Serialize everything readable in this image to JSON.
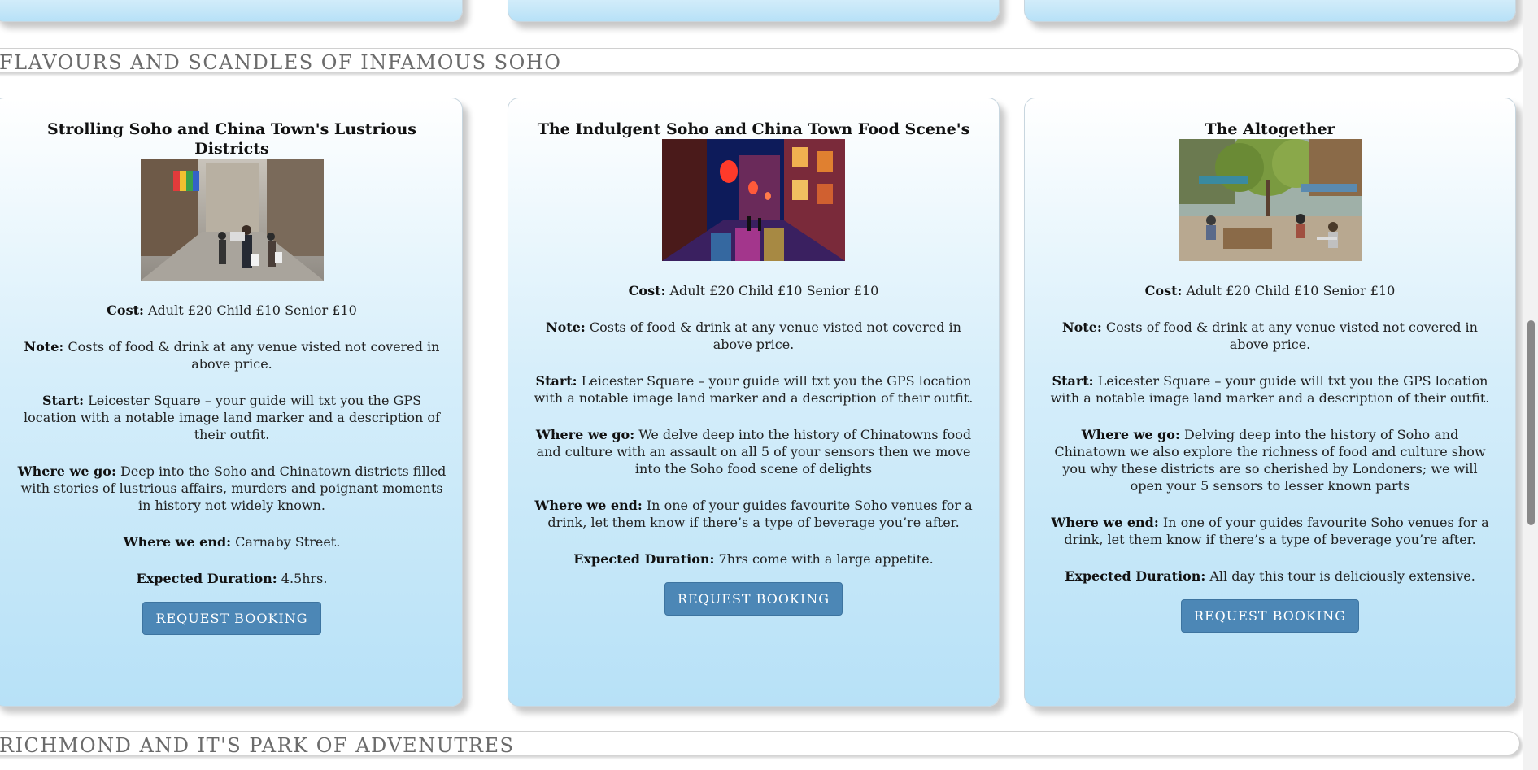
{
  "sections": [
    {
      "title": "FLAVOURS AND SCANDLES OF INFAMOUS SOHO"
    },
    {
      "title": "RICHMOND AND IT'S PARK OF ADVENUTRES"
    }
  ],
  "cards": [
    {
      "title": "Strolling Soho and China Town's Lustrious Districts",
      "image_alt": "Busy Soho street with shoppers and rainbow flags",
      "cost_label": "Cost:",
      "cost": "Adult £20 Child £10 Senior £10",
      "note_label": "Note:",
      "note": "Costs of food & drink at any venue visted not covered in above price.",
      "start_label": "Start:",
      "start": "Leicester Square – your guide will txt you the GPS location with a notable image land marker and a description of their outfit.",
      "wherego_label": "Where we go:",
      "wherego": "Deep into the Soho and Chinatown districts filled with stories of lustrious affairs, murders and poignant moments in history not widely known.",
      "whereend_label": "Where we end:",
      "whereend": "Carnaby Street.",
      "duration_label": "Expected Duration:",
      "duration": "4.5hrs.",
      "button": "REQUEST BOOKING"
    },
    {
      "title": "The Indulgent Soho and China Town Food Scene's",
      "image_alt": "Chinatown street at night with red lanterns",
      "cost_label": "Cost:",
      "cost": "Adult £20 Child £10 Senior £10",
      "note_label": "Note:",
      "note": "Costs of food & drink at any venue visted not covered in above price.",
      "start_label": "Start:",
      "start": "Leicester Square – your guide will txt you the GPS location with a notable image land marker and a description of their outfit.",
      "wherego_label": "Where we go:",
      "wherego": "We delve deep into the history of Chinatowns food and culture with an assault on all 5 of your sensors then we move into the Soho food scene of delights",
      "whereend_label": "Where we end:",
      "whereend": "In one of your guides favourite Soho venues for a drink, let them know if there’s a type of beverage you’re after.",
      "duration_label": "Expected Duration:",
      "duration": "7hrs come with a large appetite.",
      "button": "REQUEST BOOKING"
    },
    {
      "title": "The Altogether",
      "image_alt": "Outdoor courtyard dining with trees",
      "cost_label": "Cost:",
      "cost": "Adult £20 Child £10 Senior £10",
      "note_label": "Note:",
      "note": "Costs of food & drink at any venue visted not covered in above price.",
      "start_label": "Start:",
      "start": "Leicester Square – your guide will txt you the GPS location with a notable image land marker and a description of their outfit.",
      "wherego_label": "Where we go:",
      "wherego": "Delving deep into the history of Soho and Chinatown we also explore the richness of food and culture show you why these districts are so cherished by Londoners; we will open your 5 sensors to lesser known parts",
      "whereend_label": "Where we end:",
      "whereend": "In one of your guides favourite Soho venues for a drink, let them know if there’s a type of beverage you’re after.",
      "duration_label": "Expected Duration:",
      "duration": "All day this tour is deliciously extensive.",
      "button": "REQUEST BOOKING"
    }
  ],
  "colors": {
    "button_bg": "#4c87b6",
    "card_gradient_bottom": "#b7e1f7",
    "section_title": "#6b6b6b"
  }
}
